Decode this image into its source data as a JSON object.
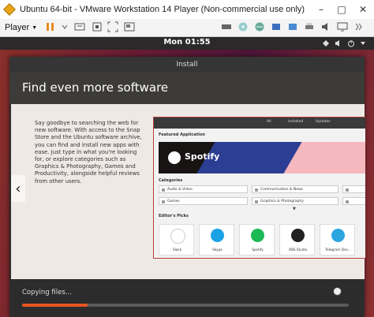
{
  "window": {
    "title": "Ubuntu 64-bit - VMware Workstation 14 Player (Non-commercial use only)"
  },
  "toolbar": {
    "player_label": "Player"
  },
  "topbar": {
    "clock": "Mon 01:55"
  },
  "installer": {
    "title": "Install",
    "heading": "Find even more software",
    "body": "Say goodbye to searching the web for new software. With access to the Snap Store and the Ubuntu software archive, you can find and install new apps with ease. Just type in what you're looking for, or explore categories such as Graphics & Photography, Games and Productivity, alongside helpful reviews from other users.",
    "status": "Copying files...",
    "progress_fraction": 0.2
  },
  "software": {
    "tabs": [
      "All",
      "Installed",
      "Updates"
    ],
    "featured_label": "Featured Application",
    "banner_app": "Spotify",
    "categories_label": "Categories",
    "categories": [
      "Audio & Video",
      "Communication & News",
      "",
      "Games",
      "Graphics & Photography",
      ""
    ],
    "picks_label": "Editor's Picks",
    "picks": [
      {
        "name": "Slack",
        "color": "#ffffff"
      },
      {
        "name": "Skype",
        "color": "#1aa1e6"
      },
      {
        "name": "Spotify",
        "color": "#1db954"
      },
      {
        "name": "OBS Studio",
        "color": "#222222"
      },
      {
        "name": "Telegram Des...",
        "color": "#2ca5e0"
      }
    ]
  },
  "colors": {
    "accent": "#e95420",
    "window_bg": "#2c2c2c"
  }
}
